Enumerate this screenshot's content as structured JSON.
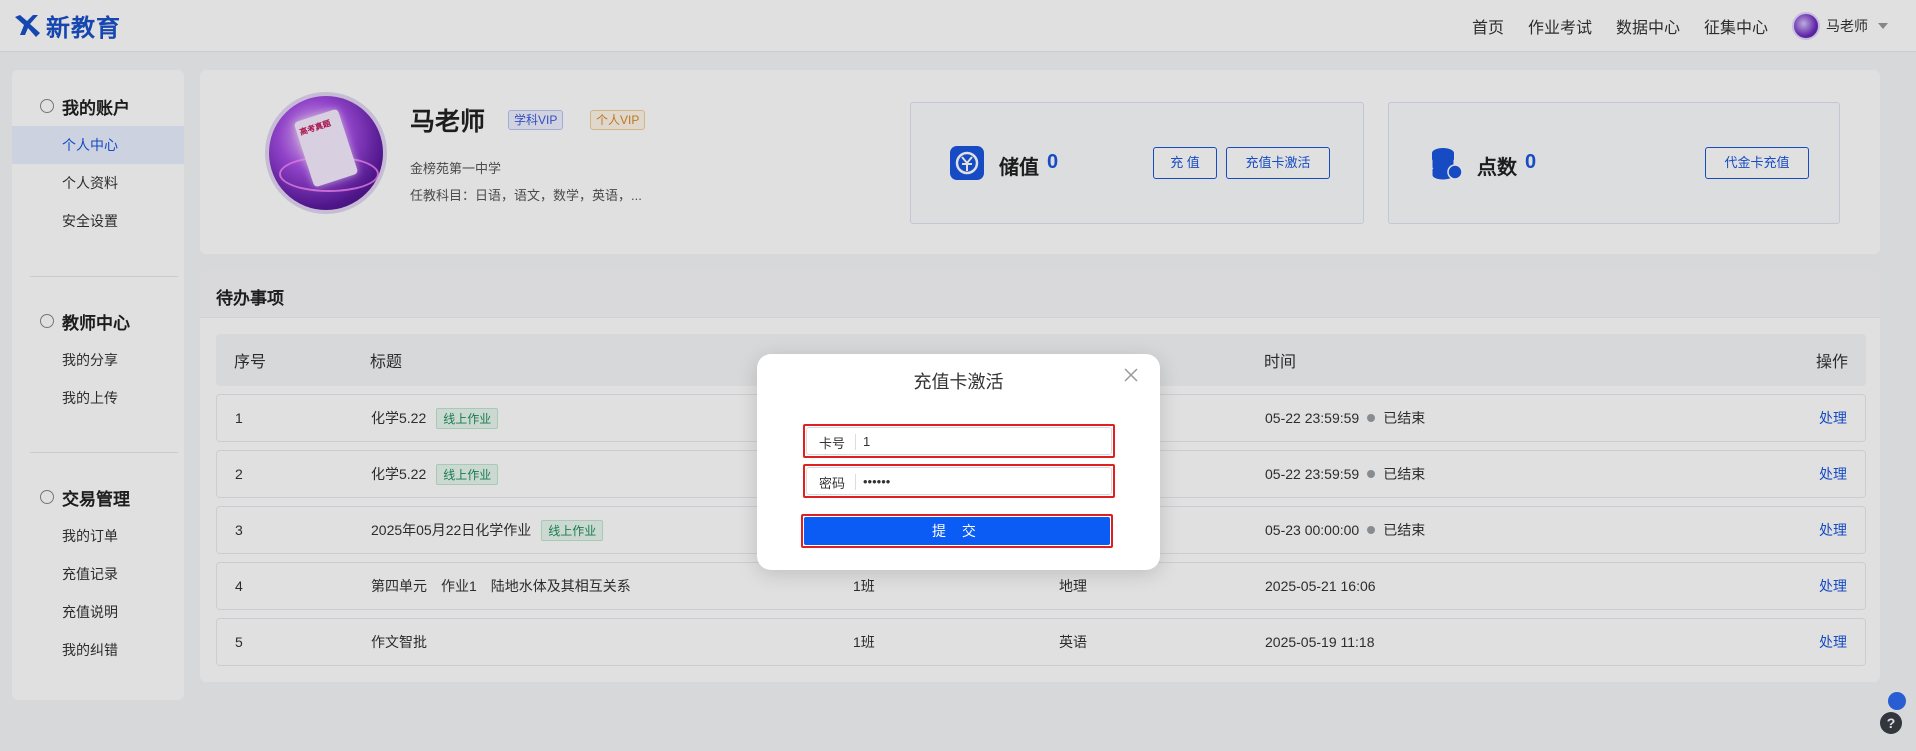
{
  "brand": {
    "name": "新教育"
  },
  "nav": {
    "items": [
      "首页",
      "作业考试",
      "数据中心",
      "征集中心"
    ],
    "user": "马老师"
  },
  "sidebar": {
    "sections": [
      {
        "title": "我的账户",
        "items": [
          "个人中心",
          "个人资料",
          "安全设置"
        ],
        "active": 0
      },
      {
        "title": "教师中心",
        "items": [
          "我的分享",
          "我的上传"
        ]
      },
      {
        "title": "交易管理",
        "items": [
          "我的订单",
          "充值记录",
          "充值说明",
          "我的纠错"
        ]
      }
    ]
  },
  "profile": {
    "avatar_text": "高考真题",
    "name": "马老师",
    "badges": [
      "学科VIP",
      "个人VIP"
    ],
    "school": "金榜苑第一中学",
    "subjects": "任教科目：日语，语文，数学，英语，..."
  },
  "balance": {
    "label": "储值",
    "value": "0",
    "btn_recharge": "充 值",
    "btn_card": "充值卡激活"
  },
  "points": {
    "label": "点数",
    "value": "0",
    "btn_voucher": "代金卡充值"
  },
  "todo": {
    "title": "待办事项",
    "columns": [
      "序号",
      "标题",
      "时间",
      "操作"
    ],
    "rows": [
      {
        "no": "1",
        "title": "化学5.22",
        "tag": "线上作业",
        "cls": "",
        "subject": "",
        "time": "05-22 23:59:59",
        "status": "已结束",
        "action": "处理"
      },
      {
        "no": "2",
        "title": "化学5.22",
        "tag": "线上作业",
        "cls": "",
        "subject": "",
        "time": "05-22 23:59:59",
        "status": "已结束",
        "action": "处理"
      },
      {
        "no": "3",
        "title": "2025年05月22日化学作业",
        "tag": "线上作业",
        "cls": "",
        "subject": "",
        "time": "05-23 00:00:00",
        "status": "已结束",
        "action": "处理"
      },
      {
        "no": "4",
        "title": "第四单元　作业1　陆地水体及其相互关系",
        "tag": "",
        "cls": "1班",
        "subject": "地理",
        "time": "2025-05-21 16:06",
        "status": "",
        "action": "处理"
      },
      {
        "no": "5",
        "title": "作文智批",
        "tag": "",
        "cls": "1班",
        "subject": "英语",
        "time": "2025-05-19 11:18",
        "status": "",
        "action": "处理"
      }
    ]
  },
  "modal": {
    "title": "充值卡激活",
    "card_label": "卡号",
    "card_value": "1",
    "password_label": "密码",
    "password_value": "123456",
    "submit": "提 交"
  },
  "colors": {
    "primary": "#1a56e0",
    "submit": "#0b5bf5",
    "highlight": "#e02020",
    "tag": "#1c8f58"
  }
}
